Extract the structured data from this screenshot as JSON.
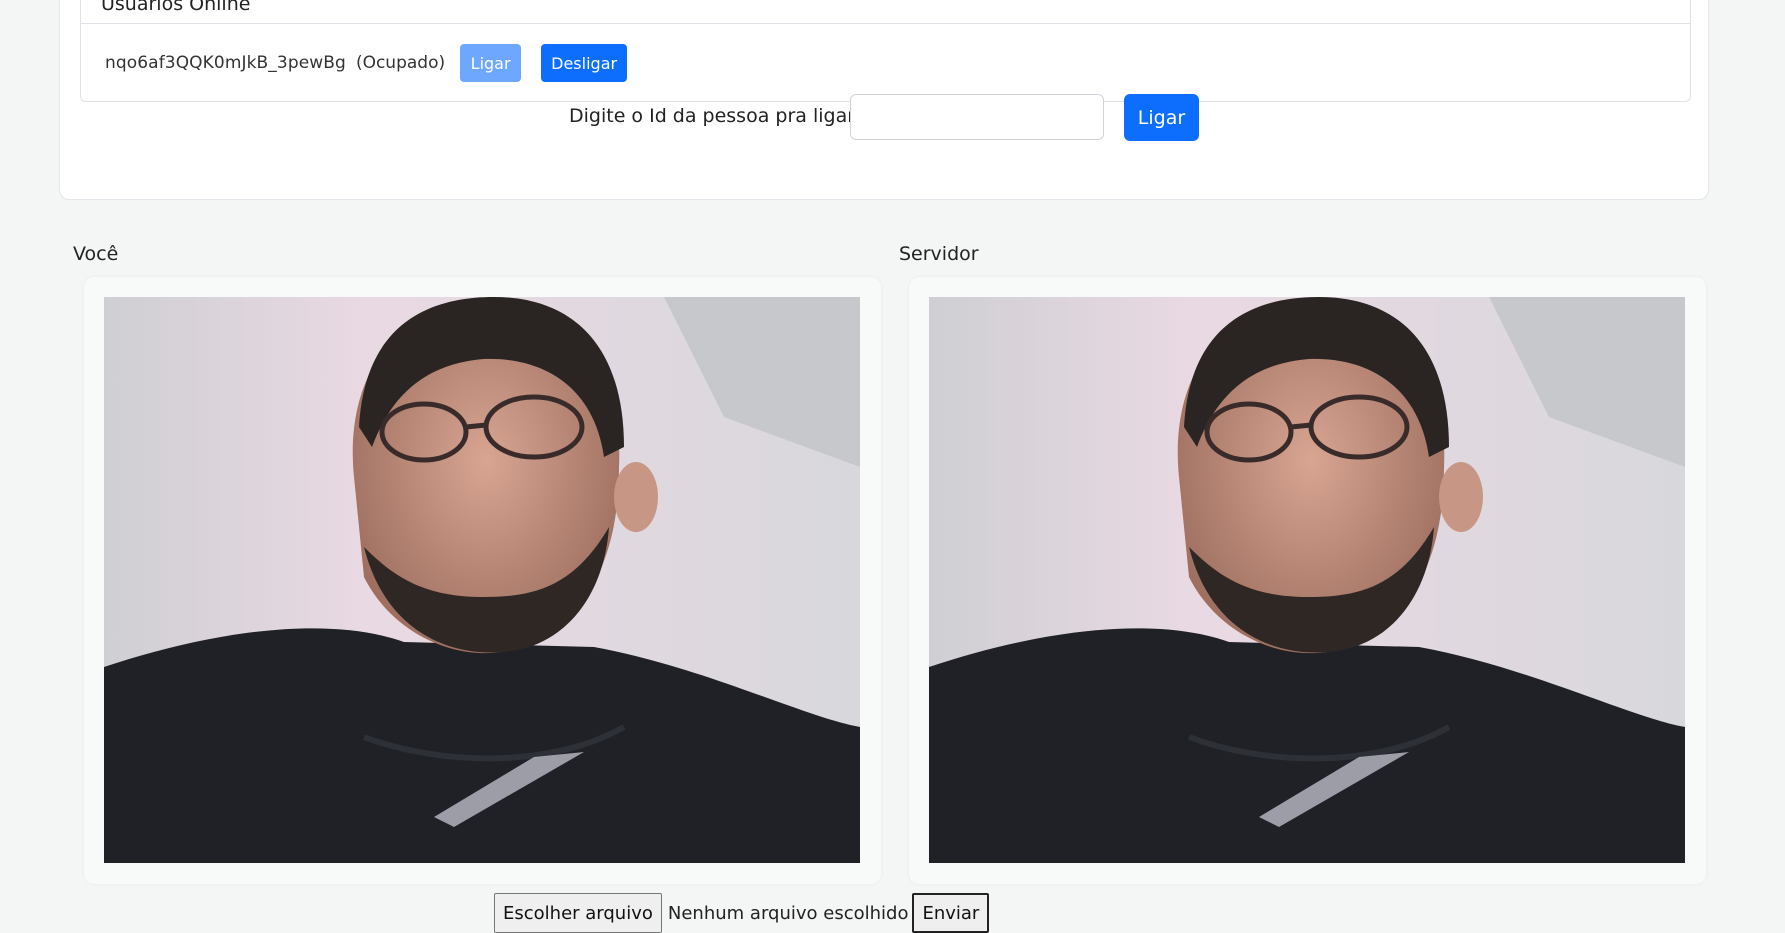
{
  "online": {
    "title": "Usuários Online",
    "users": [
      {
        "id": "nqo6af3QQK0mJkB_3pewBg",
        "status": "(Ocupado)",
        "call_label": "Ligar",
        "hangup_label": "Desligar"
      }
    ]
  },
  "call": {
    "label": "Digite o Id da pessoa pra ligar",
    "input_value": "",
    "button_label": "Ligar"
  },
  "videos": {
    "local_label": "Você",
    "remote_label": "Servidor"
  },
  "file": {
    "choose_label": "Escolher arquivo",
    "status": "Nenhum arquivo escolhido",
    "send_label": "Enviar"
  },
  "colors": {
    "primary": "#0d6efd",
    "primary_disabled": "#6ea8fe",
    "background": "#f4f5f5"
  }
}
